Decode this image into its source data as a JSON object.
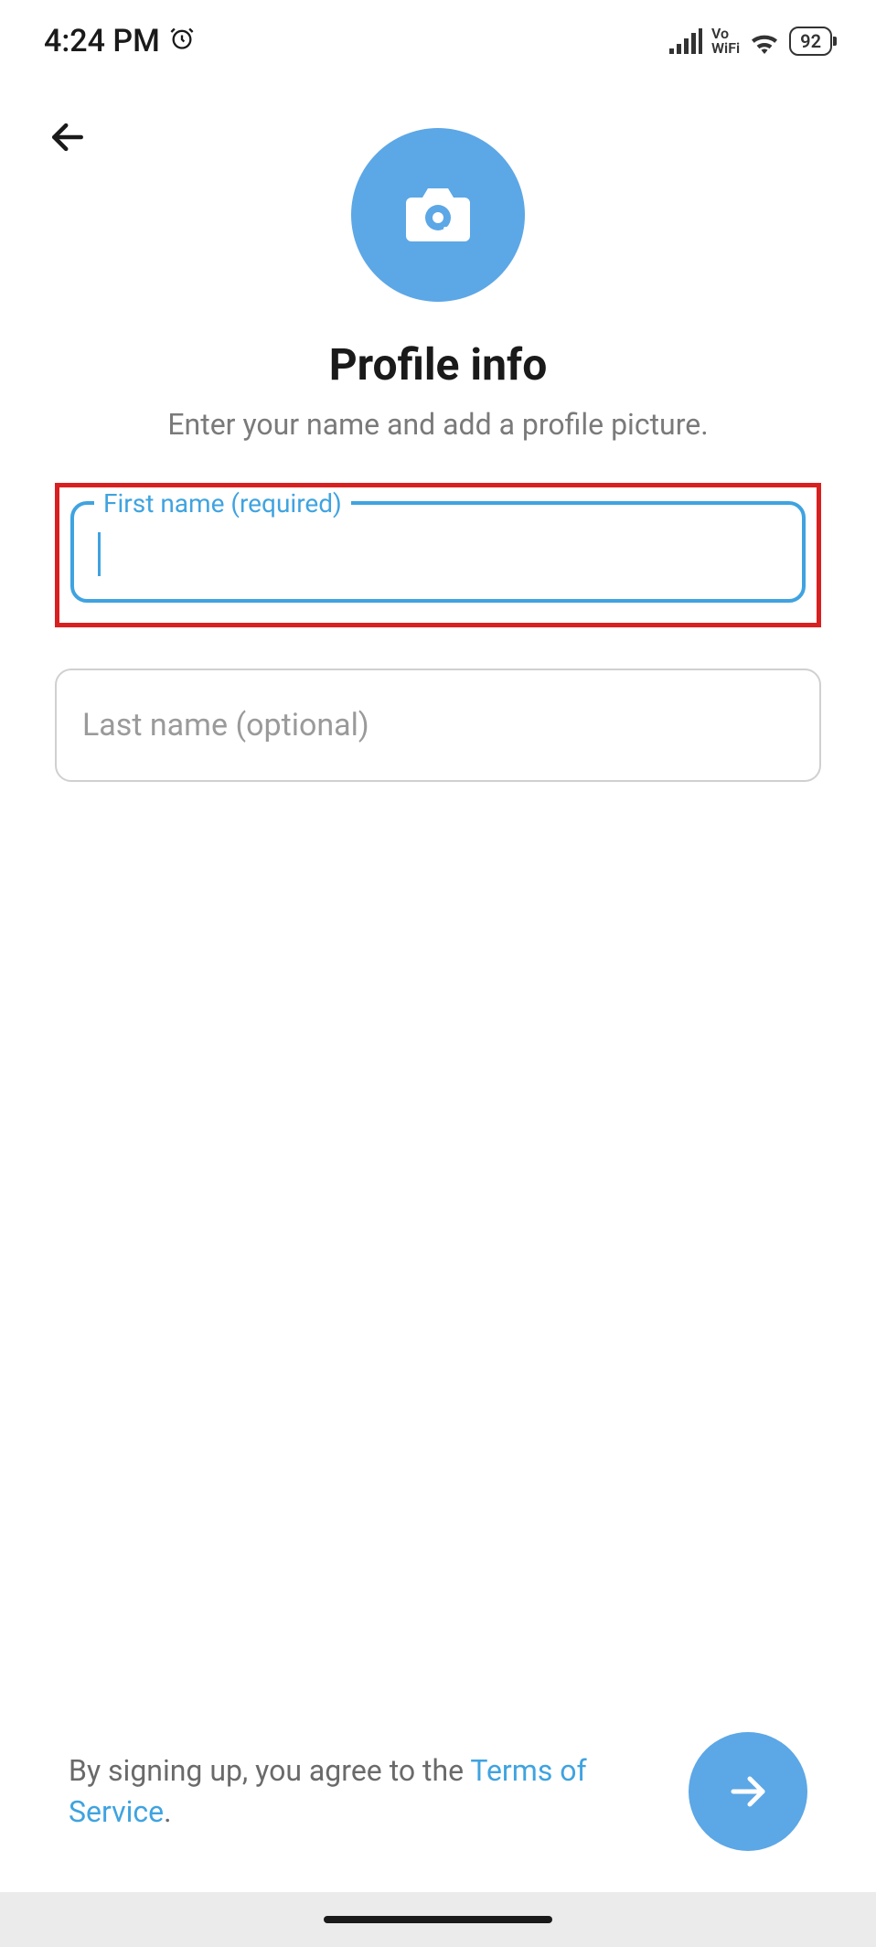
{
  "status_bar": {
    "time": "4:24 PM",
    "vowifi_top": "Vo",
    "vowifi_bottom": "WiFi",
    "battery": "92"
  },
  "header": {
    "title": "Profile info",
    "subtitle": "Enter your name and add a profile picture."
  },
  "form": {
    "first_name_label": "First name (required)",
    "first_name_value": "",
    "last_name_placeholder": "Last name (optional)",
    "last_name_value": ""
  },
  "footer": {
    "agree_prefix": "By signing up, you agree to the ",
    "tos_link": "Terms of Service",
    "period": "."
  }
}
